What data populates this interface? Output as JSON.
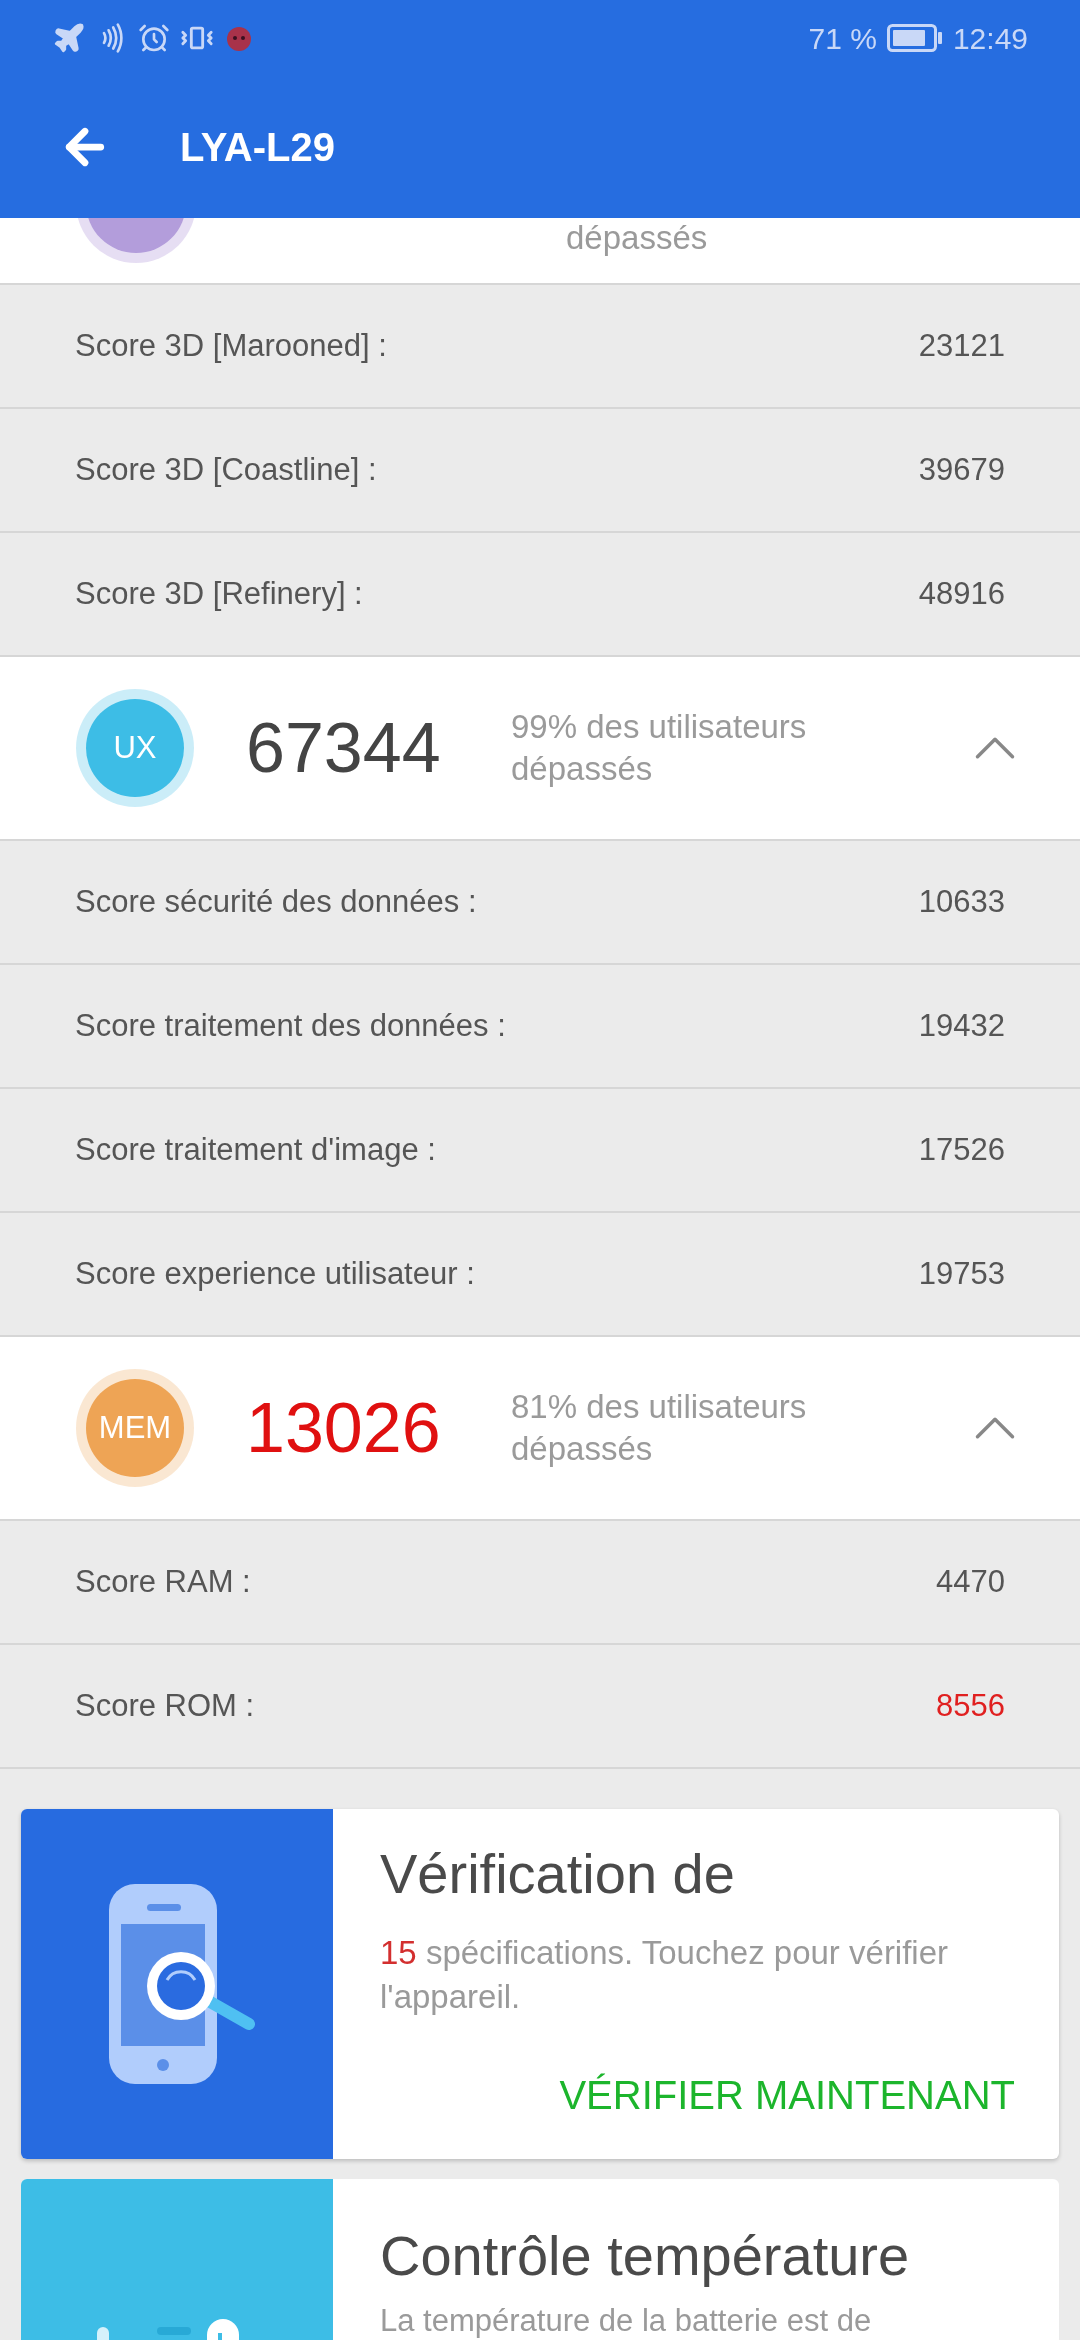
{
  "status_bar": {
    "battery": "71 %",
    "time": "12:49"
  },
  "app_bar": {
    "title": "LYA-L29"
  },
  "sections": [
    {
      "header": {
        "kind": "partial",
        "color": "#b39ddb",
        "summary": "dépassés"
      },
      "rows": [
        {
          "label": "Score 3D [Marooned] :",
          "value": "23121",
          "alert": false
        },
        {
          "label": "Score 3D [Coastline] :",
          "value": "39679",
          "alert": false
        },
        {
          "label": "Score 3D [Refinery] :",
          "value": "48916",
          "alert": false
        }
      ]
    },
    {
      "header": {
        "kind": "full",
        "badge": "UX",
        "color": "#3dbde6",
        "score": "67344",
        "alert": false,
        "summary": "99% des utilisateurs dépassés",
        "expanded": true
      },
      "rows": [
        {
          "label": "Score sécurité des données :",
          "value": "10633",
          "alert": false
        },
        {
          "label": "Score traitement des données :",
          "value": "19432",
          "alert": false
        },
        {
          "label": "Score traitement d'image :",
          "value": "17526",
          "alert": false
        },
        {
          "label": "Score experience utilisateur :",
          "value": "19753",
          "alert": false
        }
      ]
    },
    {
      "header": {
        "kind": "full",
        "badge": "MEM",
        "color": "#eea455",
        "score": "13026",
        "alert": true,
        "summary": "81% des utilisateurs dépassés",
        "expanded": true
      },
      "rows": [
        {
          "label": "Score RAM :",
          "value": "4470",
          "alert": false
        },
        {
          "label": "Score ROM :",
          "value": "8556",
          "alert": true
        }
      ]
    }
  ],
  "cards": [
    {
      "kind": "verify",
      "title": "Vérification de",
      "count": "15",
      "description": "spécifications. Touchez pour vérifier l'appareil.",
      "action": "VÉRIFIER MAINTENANT"
    },
    {
      "kind": "temperature",
      "title": "Contrôle température",
      "description": "La température de la batterie est de"
    }
  ]
}
